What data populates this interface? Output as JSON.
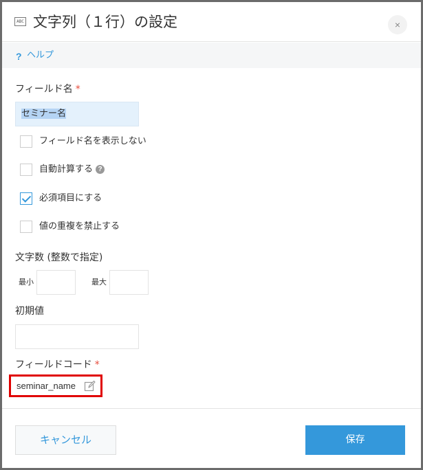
{
  "header": {
    "icon_text": "ABC",
    "title": "文字列（１行）の設定",
    "close_label": "×"
  },
  "help": {
    "icon": "?",
    "link_label": "ヘルプ"
  },
  "field_name": {
    "label": "フィールド名",
    "required_mark": "*",
    "value": "セミナー名"
  },
  "options": [
    {
      "label": "フィールド名を表示しない",
      "checked": false
    },
    {
      "label": "自動計算する",
      "checked": false,
      "help_icon": "?"
    },
    {
      "label": "必須項目にする",
      "checked": true
    },
    {
      "label": "値の重複を禁止する",
      "checked": false
    }
  ],
  "char_count": {
    "label": "文字数 (整数で指定)",
    "min_label": "最小",
    "min_value": "",
    "max_label": "最大",
    "max_value": ""
  },
  "initial_value": {
    "label": "初期値",
    "value": ""
  },
  "field_code": {
    "label": "フィールドコード",
    "required_mark": "*",
    "value": "seminar_name"
  },
  "footer": {
    "cancel_label": "キャンセル",
    "save_label": "保存"
  },
  "colors": {
    "accent": "#3498db",
    "required": "#e74c3c",
    "highlight_border": "#e00000"
  }
}
